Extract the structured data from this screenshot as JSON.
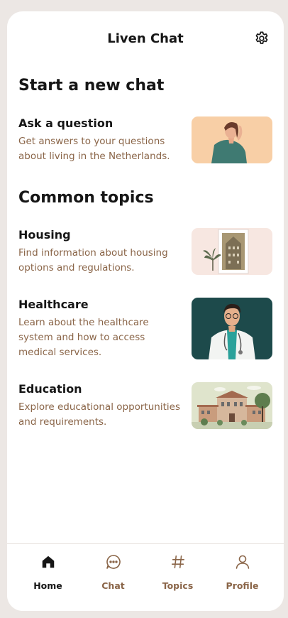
{
  "header": {
    "title": "Liven Chat",
    "settings_icon": "gear-icon"
  },
  "new_chat": {
    "title": "Start a new chat",
    "card": {
      "title": "Ask a question",
      "description": "Get answers to your questions about living in the Netherlands."
    }
  },
  "topics": {
    "title": "Common topics",
    "items": [
      {
        "title": "Housing",
        "description": "Find information about housing options and regulations."
      },
      {
        "title": "Healthcare",
        "description": "Learn about the healthcare system and how to access medical services."
      },
      {
        "title": "Education",
        "description": "Explore educational opportunities and requirements."
      }
    ]
  },
  "tabs": [
    {
      "label": "Home",
      "icon": "home-icon",
      "active": true
    },
    {
      "label": "Chat",
      "icon": "chat-bubble-icon",
      "active": false
    },
    {
      "label": "Topics",
      "icon": "hash-icon",
      "active": false
    },
    {
      "label": "Profile",
      "icon": "user-icon",
      "active": false
    }
  ],
  "colors": {
    "text_primary": "#161616",
    "text_secondary": "#8a6548",
    "background": "#ece7e4",
    "card_surface": "#ffffff"
  }
}
